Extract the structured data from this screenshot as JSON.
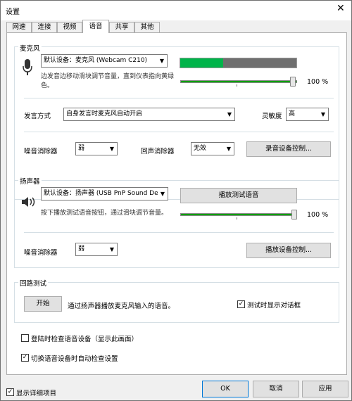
{
  "window": {
    "title": "设置",
    "close_glyph": "✕"
  },
  "tabs": [
    {
      "label": "网速",
      "active": false
    },
    {
      "label": "连接",
      "active": false
    },
    {
      "label": "视频",
      "active": false
    },
    {
      "label": "语音",
      "active": true
    },
    {
      "label": "共享",
      "active": false
    },
    {
      "label": "其他",
      "active": false
    }
  ],
  "microphone": {
    "group_label": "麦克风",
    "icon": "microphone-icon",
    "device": "默认设备：麦克风 (Webcam C210)",
    "hint": "边发音边移动滑块调节音量，直到仪表指向黄绿色。",
    "meter_level": 0.37,
    "volume_percent": 100,
    "volume_label": "100 %",
    "speak_mode_label": "发言方式",
    "speak_mode_value": "自身发言时麦克风自动开启",
    "sensitivity_label": "灵敏度",
    "sensitivity_value": "高",
    "noise_label": "噪音消除器",
    "noise_value": "弱",
    "echo_label": "回声消除器",
    "echo_value": "无效",
    "record_button": "录音设备控制..."
  },
  "speaker": {
    "group_label": "扬声器",
    "icon": "speaker-icon",
    "device": "默认设备：扬声器 (USB PnP Sound Dev",
    "test_button": "播放测试语音",
    "hint": "按下播放测试语音按钮，通过滑块调节音量。",
    "volume_percent": 100,
    "volume_label": "100 %",
    "noise_label": "噪音消除器",
    "noise_value": "弱",
    "control_button": "播放设备控制..."
  },
  "loopback": {
    "group_label": "回路测试",
    "start_button": "开始",
    "description": "通过扬声器播放麦克风输入的语音。",
    "show_dialog_label": "测试时显示对话框",
    "show_dialog_checked": true
  },
  "options": {
    "check_on_login_label": "登陆时检查语音设备（显示此画面）",
    "check_on_login_checked": false,
    "auto_check_label": "切换语音设备时自动检查设置",
    "auto_check_checked": true
  },
  "footer": {
    "show_details_label": "显示详细项目",
    "show_details_checked": true,
    "ok": "OK",
    "cancel": "取消",
    "apply": "应用"
  },
  "check_mark": "✓",
  "dropdown_arrow": "▼"
}
